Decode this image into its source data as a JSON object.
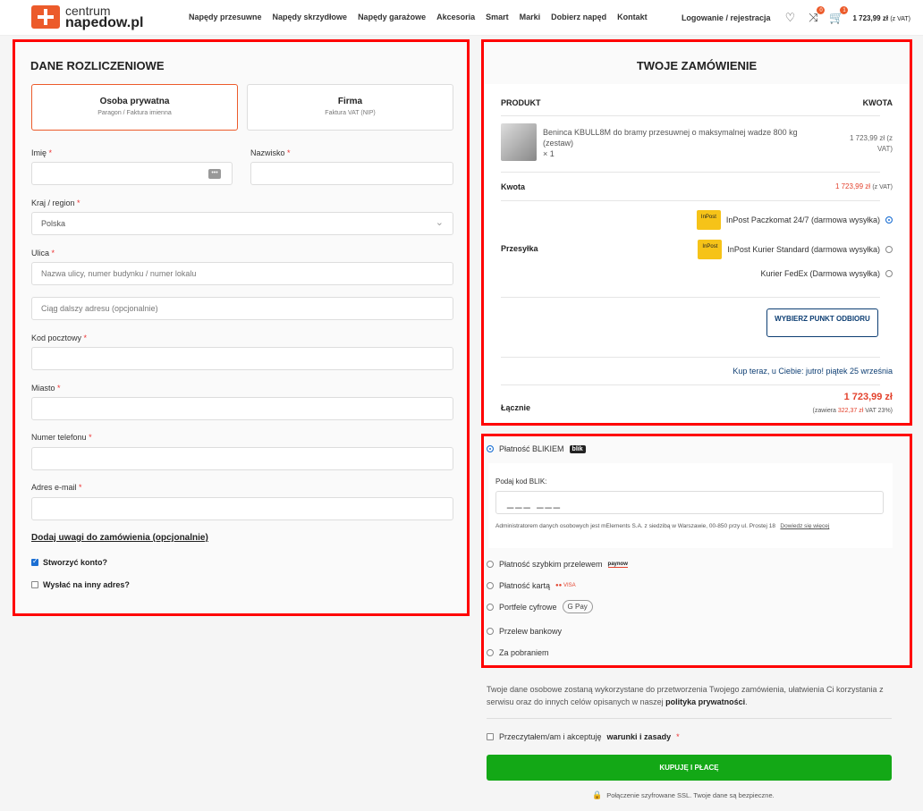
{
  "header": {
    "logo_line1": "centrum",
    "logo_line2": "napedow.pl",
    "nav": [
      "Napędy przesuwne",
      "Napędy skrzydłowe",
      "Napędy garażowe",
      "Akcesoria",
      "Smart",
      "Marki",
      "Dobierz napęd",
      "Kontakt"
    ],
    "login": "Logowanie / rejestracja",
    "compare_badge": "0",
    "cart_badge": "1",
    "cart_total": "1 723,99 zł",
    "cart_vat": "(z VAT)"
  },
  "billing": {
    "title": "DANE ROZLICZENIOWE",
    "type_private": "Osoba prywatna",
    "type_private_sub": "Paragon / Faktura imienna",
    "type_company": "Firma",
    "type_company_sub": "Faktura VAT (NIP)",
    "first_name_label": "Imię",
    "last_name_label": "Nazwisko",
    "country_label": "Kraj / region",
    "country_value": "Polska",
    "street_label": "Ulica",
    "street_placeholder": "Nazwa ulicy, numer budynku / numer lokalu",
    "street2_placeholder": "Ciąg dalszy adresu (opcjonalnie)",
    "postcode_label": "Kod pocztowy",
    "city_label": "Miasto",
    "phone_label": "Numer telefonu",
    "email_label": "Adres e-mail",
    "req": "*",
    "notes_link": "Dodaj uwagi do zamówienia (opcjonalnie)",
    "create_account": "Stworzyć konto?",
    "ship_other": "Wysłać na inny adres?"
  },
  "order": {
    "title": "TWOJE ZAMÓWIENIE",
    "col_product": "PRODUKT",
    "col_amount": "KWOTA",
    "product_name": "Beninca KBULL8M do bramy przesuwnej o maksymalnej wadze 800 kg (zestaw)",
    "product_qty": "× 1",
    "product_price": "1 723,99 zł",
    "product_price_vat": "(z VAT)",
    "subtotal_label": "Kwota",
    "subtotal_value": "1 723,99 zł",
    "subtotal_vat": "(z VAT)",
    "shipping_label": "Przesyłka",
    "shipping_options": [
      "InPost Paczkomat 24/7 (darmowa wysyłka)",
      "InPost Kurier Standard (darmowa wysyłka)",
      "Kurier FedEx (Darmowa wysyłka)"
    ],
    "inpost_logo": "InPost",
    "pick_button": "WYBIERZ PUNKT ODBIORU",
    "delivery_note": "Kup teraz, u Ciebie: jutro! piątek 25 września",
    "total_label": "Łącznie",
    "total_value": "1 723,99 zł",
    "total_vat_prefix": "(zawiera",
    "total_vat_amount": "322,37 zł",
    "total_vat_suffix": "VAT 23%)"
  },
  "payment": {
    "blik_label": "Płatność BLIKIEM",
    "blik_logo": "blik",
    "blik_code_label": "Podaj kod BLIK:",
    "blik_placeholder": "___ ___",
    "blik_note": "Administratorem danych osobowych jest mElements S.A. z siedzibą w Warszawie, 00-850 przy ul. Prostej 18",
    "blik_note_link": "Dowiedz się więcej",
    "options": [
      "Płatność szybkim przelewem",
      "Płatność kartą",
      "Portfele cyfrowe",
      "Przelew bankowy",
      "Za pobraniem"
    ],
    "paynow_logo": "paynow",
    "cards_logo": "●● VISA",
    "gpay_logo": "G Pay"
  },
  "footer": {
    "privacy_text": "Twoje dane osobowe zostaną wykorzystane do przetworzenia Twojego zamówienia, ułatwienia Ci korzystania z serwisu oraz do innych celów opisanych w naszej",
    "privacy_link": "polityka prywatności",
    "terms_prefix": "Przeczytałem/am i akceptuję",
    "terms_link": "warunki i zasady",
    "buy_button": "KUPUJĘ I PŁACĘ",
    "ssl_note": "Połączenie szyfrowane SSL. Twoje dane są bezpieczne."
  }
}
